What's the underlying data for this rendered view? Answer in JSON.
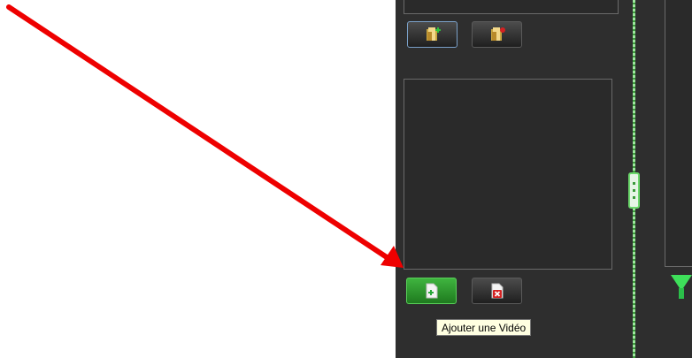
{
  "annotation": {
    "arrow_color": "#ee0000",
    "icon": "red-arrow-icon"
  },
  "panel": {
    "background": "#2e2e2e",
    "splitter_color": "#6cd86c"
  },
  "buttons": {
    "add_folder": {
      "icon": "folder-add-icon",
      "state": "focused"
    },
    "remove_folder": {
      "icon": "folder-remove-icon",
      "state": "normal"
    },
    "add_video": {
      "icon": "file-add-icon",
      "state": "highlighted",
      "color": "#2e9b2e"
    },
    "remove_video": {
      "icon": "file-remove-icon",
      "state": "normal"
    }
  },
  "tooltip": {
    "text": "Ajouter une Vidéo"
  }
}
